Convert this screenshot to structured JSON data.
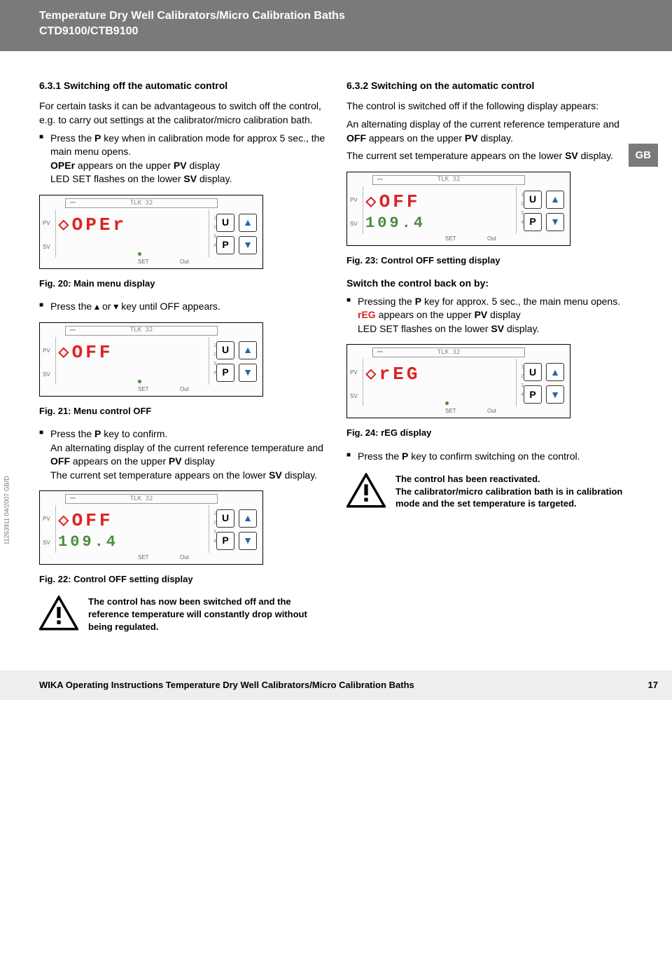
{
  "header": {
    "title_line1": "Temperature Dry Well Calibrators/Micro Calibration Baths",
    "title_line2": "CTD9100/CTB9100"
  },
  "lang_tab": "GB",
  "left": {
    "h631": "6.3.1 Switching off the automatic control",
    "p1": "For certain tasks it can be advantageous to switch off the control, e.g. to carry out settings at the calibrator/micro calibration bath.",
    "b1_a": "Press the ",
    "b1_key": "P",
    "b1_b": " key when in calibration mode for approx 5 sec., the main menu opens.",
    "b1_c": "OPEr",
    "b1_d": " appears on the upper ",
    "b1_pv": "PV",
    "b1_e": " display",
    "b1_f": "LED SET flashes on the lower ",
    "b1_sv": "SV",
    "b1_g": " display.",
    "fig20": "Fig. 20: Main menu display",
    "b2": "Press the ▴ or ▾ key until OFF appears.",
    "fig21": "Fig. 21: Menu control OFF",
    "b3_a": "Press the ",
    "b3_key": "P",
    "b3_b": " key to confirm.",
    "b3_c": "An alternating display of the current reference temperature and ",
    "b3_off": "OFF",
    "b3_d": " appears on the upper ",
    "b3_pv": "PV",
    "b3_e": " display",
    "b3_f": "The current set temperature appears on the lower ",
    "b3_sv": "SV",
    "b3_g": " display.",
    "fig22": "Fig. 22: Control OFF setting display",
    "warn1": "The control has now been switched off and the reference temperature will constantly drop without being regulated."
  },
  "right": {
    "h632": "6.3.2 Switching on the automatic control",
    "p1": "The control is switched off if the following display appears:",
    "p2a": "An alternating display of the current reference temperature and ",
    "p2off": "OFF",
    "p2b": " appears on the upper ",
    "p2pv": "PV",
    "p2c": " display.",
    "p3a": "The current set temperature appears on the lower ",
    "p3sv": "SV",
    "p3b": " display.",
    "fig23": "Fig. 23: Control OFF setting display",
    "switch_back": "Switch the control back on by:",
    "b1_a": "Pressing the ",
    "b1_key": "P",
    "b1_b": " key for approx. 5 sec., the main menu opens.",
    "b1_reg": "rEG",
    "b1_c": " appears on the upper ",
    "b1_pv": "PV",
    "b1_d": " display",
    "b1_e": "LED SET flashes on the lower ",
    "b1_sv": "SV",
    "b1_f": " display.",
    "fig24": "Fig. 24: rEG display",
    "b2_a": "Press the ",
    "b2_key": "P",
    "b2_b": " key to confirm switching on the control.",
    "warn2a": "The control has been reactivated.",
    "warn2b": "The calibrator/micro calibration bath is in calibration mode and the set temperature is targeted."
  },
  "panels": {
    "tlk": "TLK 32",
    "pv": "PV",
    "sv": "SV",
    "set": "SET",
    "out": "Out",
    "btn_u": "U",
    "btn_p": "P",
    "oper": "OPEr",
    "off": "OFF",
    "val": "109.4",
    "reg": "rEG",
    "nums": "1\n2\n3\n4"
  },
  "footer": {
    "left": "WIKA Operating Instructions Temperature Dry Well Calibrators/Micro Calibration Baths",
    "right": "17"
  },
  "side_code": "11263911 04/2007 GB/D"
}
